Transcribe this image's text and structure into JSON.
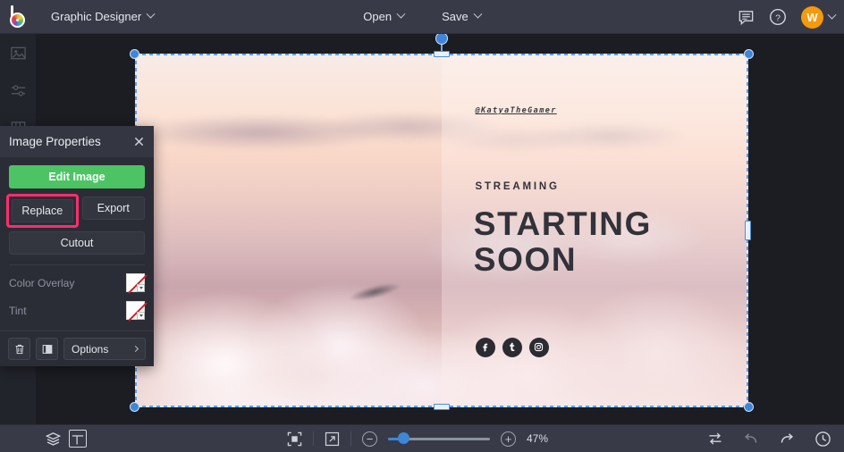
{
  "app": {
    "logo_name": "befunky-logo",
    "document_title": "Graphic Designer"
  },
  "topbar": {
    "open_label": "Open",
    "save_label": "Save",
    "feedback_icon": "comment-icon",
    "help_icon": "question-circle-icon",
    "avatar_initial": "W"
  },
  "left_rail": {
    "items": [
      {
        "name": "sidebar-item-image",
        "icon": "image-icon"
      },
      {
        "name": "sidebar-item-adjust",
        "icon": "sliders-icon"
      },
      {
        "name": "sidebar-item-templates",
        "icon": "columns-icon"
      }
    ]
  },
  "panel": {
    "title": "Image Properties",
    "close_icon": "close-icon",
    "edit_image_label": "Edit Image",
    "replace_label": "Replace",
    "export_label": "Export",
    "cutout_label": "Cutout",
    "color_overlay_label": "Color Overlay",
    "tint_label": "Tint",
    "color_overlay_value": "none",
    "tint_value": "none",
    "delete_icon": "trash-icon",
    "duplicate_icon": "duplicate-icon",
    "options_label": "Options",
    "highlight_color": "#ff2d6b",
    "accent_green": "#4cc464"
  },
  "canvas": {
    "design": {
      "handle": "@KatyaTheGamer",
      "kicker": "STREAMING",
      "headline_line1": "STARTING",
      "headline_line2": "SOON",
      "socials": [
        {
          "name": "facebook-icon",
          "label": "f"
        },
        {
          "name": "tumblr-icon",
          "label": "t"
        },
        {
          "name": "instagram-icon",
          "label": "ig"
        }
      ]
    },
    "selection": {
      "active": true,
      "handle_color": "#3f86d8"
    }
  },
  "bottombar": {
    "layers_icon": "layers-icon",
    "layout_icon": "layout-icon",
    "fit_icon": "fit-to-screen-icon",
    "fullscreen_icon": "expand-icon",
    "zoom_out_label": "−",
    "zoom_in_label": "+",
    "zoom_value": "47%",
    "swap_icon": "swap-icon",
    "undo_icon": "undo-icon",
    "redo_icon": "redo-icon",
    "history_icon": "history-clock-icon"
  }
}
